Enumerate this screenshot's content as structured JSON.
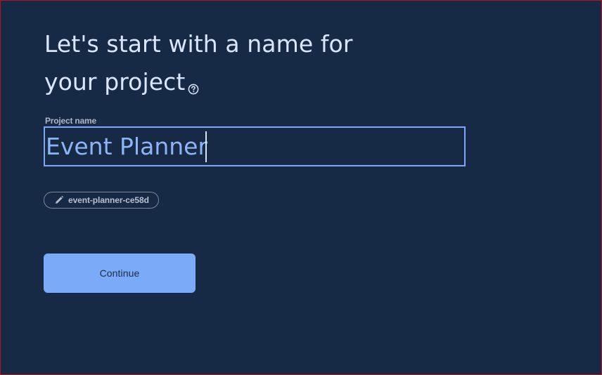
{
  "heading": {
    "line1": "Let's start with a name for",
    "line2": "your project",
    "help_icon": "help-circle-icon"
  },
  "project_name": {
    "label": "Project name",
    "value": "Event Planner"
  },
  "project_id_chip": {
    "icon": "pencil-icon",
    "text": "event-planner-ce58d"
  },
  "actions": {
    "continue_label": "Continue"
  },
  "colors": {
    "background": "#172a45",
    "accent": "#7babf8",
    "heading": "#d9e6fb",
    "input_text": "#8db4f6"
  }
}
